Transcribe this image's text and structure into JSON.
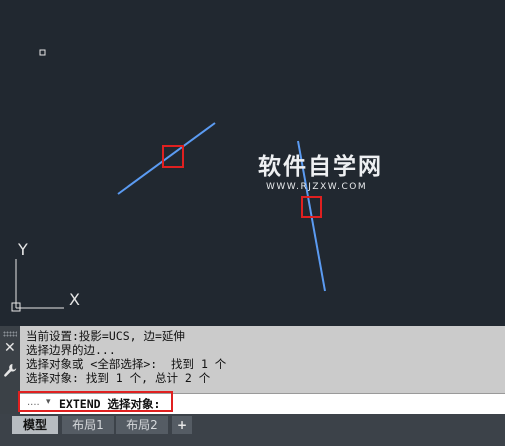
{
  "canvas": {
    "ucs_icon": {
      "y_label": "Y",
      "x_label": "X"
    },
    "watermark": {
      "title": "软件自学网",
      "url": "WWW.RJZXW.COM"
    }
  },
  "command_panel": {
    "history": [
      "当前设置:投影=UCS, 边=延伸",
      "选择边界的边...",
      "选择对象或 <全部选择>:  找到 1 个",
      "选择对象: 找到 1 个, 总计 2 个"
    ],
    "input": {
      "dots": "....",
      "caret": "▾",
      "text": "EXTEND 选择对象:"
    },
    "icons": [
      "close-icon",
      "wrench-icon"
    ]
  },
  "tabs": [
    {
      "label": "模型",
      "active": true
    },
    {
      "label": "布局1",
      "active": false
    },
    {
      "label": "布局2",
      "active": false
    },
    {
      "label": "+",
      "active": false
    }
  ],
  "colors": {
    "canvas_bg": "#212830",
    "line": "#5b9bf2",
    "highlight": "#e02020"
  }
}
